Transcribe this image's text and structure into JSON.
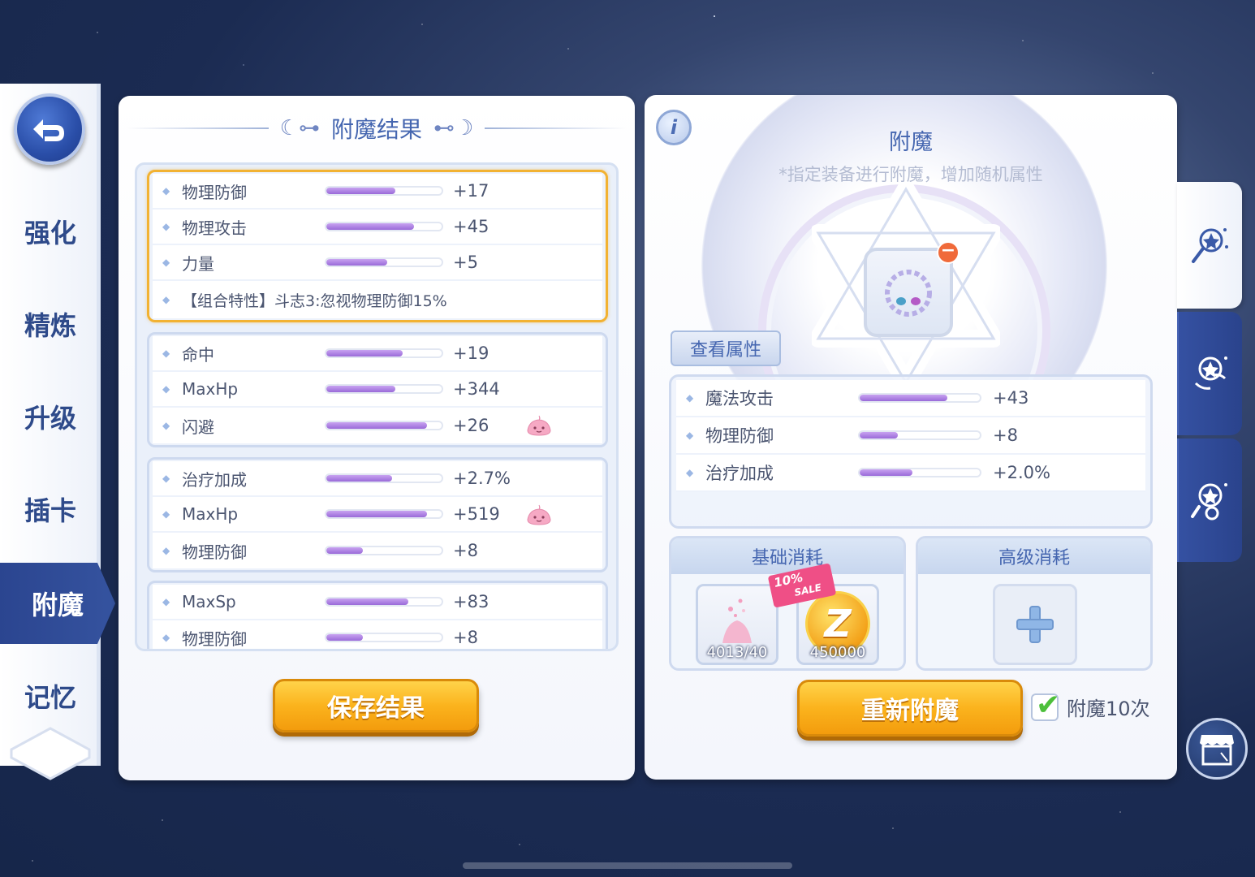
{
  "sidebar": {
    "back_icon": "back-arrow-icon",
    "tabs": [
      {
        "label": "强化"
      },
      {
        "label": "精炼"
      },
      {
        "label": "升级"
      },
      {
        "label": "插卡"
      },
      {
        "label": "附魔",
        "active": true
      },
      {
        "label": "记忆"
      }
    ]
  },
  "results_panel": {
    "title": "附魔结果",
    "groups": [
      {
        "selected": true,
        "rows": [
          {
            "name": "物理防御",
            "value": "+17",
            "fill": 0.6
          },
          {
            "name": "物理攻击",
            "value": "+45",
            "fill": 0.76
          },
          {
            "name": "力量",
            "value": "+5",
            "fill": 0.53
          }
        ],
        "combo": "【组合特性】斗志3:忽视物理防御15%"
      },
      {
        "selected": false,
        "rows": [
          {
            "name": "命中",
            "value": "+19",
            "fill": 0.66
          },
          {
            "name": "MaxHp",
            "value": "+344",
            "fill": 0.6
          },
          {
            "name": "闪避",
            "value": "+26",
            "fill": 0.87,
            "icon": "poring-icon"
          }
        ]
      },
      {
        "selected": false,
        "rows": [
          {
            "name": "治疗加成",
            "value": "+2.7%",
            "fill": 0.57
          },
          {
            "name": "MaxHp",
            "value": "+519",
            "fill": 0.87,
            "icon": "poring-icon"
          },
          {
            "name": "物理防御",
            "value": "+8",
            "fill": 0.32
          }
        ]
      },
      {
        "selected": false,
        "rows": [
          {
            "name": "MaxSp",
            "value": "+83",
            "fill": 0.71
          },
          {
            "name": "物理防御",
            "value": "+8",
            "fill": 0.32
          }
        ]
      }
    ],
    "save_label": "保存结果"
  },
  "enchant_panel": {
    "title": "附魔",
    "subtitle": "*指定装备进行附魔，增加随机属性",
    "info_icon": "i",
    "view_attrs_label": "查看属性",
    "current_attrs": [
      {
        "name": "魔法攻击",
        "value": "+43",
        "fill": 0.73
      },
      {
        "name": "物理防御",
        "value": "+8",
        "fill": 0.32
      },
      {
        "name": "治疗加成",
        "value": "+2.0%",
        "fill": 0.44
      }
    ],
    "basic_cost": {
      "title": "基础消耗",
      "items": [
        {
          "icon": "enchant-material-icon",
          "qty": "4013/40"
        },
        {
          "icon": "zeny-coin-icon",
          "qty": "450000",
          "coin_letter": "Z"
        }
      ],
      "sale_tag": {
        "percent": "10%",
        "label": "SALE"
      }
    },
    "advanced_cost": {
      "title": "高级消耗",
      "icon": "plus-icon"
    },
    "reenchant_label": "重新附魔",
    "batch_label": "附魔10次",
    "batch_checked": true
  },
  "right_tabs": [
    {
      "icon": "magic-wand-star-icon",
      "active": true
    },
    {
      "icon": "magic-swap-icon",
      "active": false
    },
    {
      "icon": "magic-refresh-icon",
      "active": false
    }
  ],
  "shop_icon": "shop-icon",
  "colors": {
    "accent_blue": "#2b4590",
    "bar_purple": "#9a6ad8",
    "selected_border": "#f2b232",
    "button_orange": "#fbb31d"
  }
}
